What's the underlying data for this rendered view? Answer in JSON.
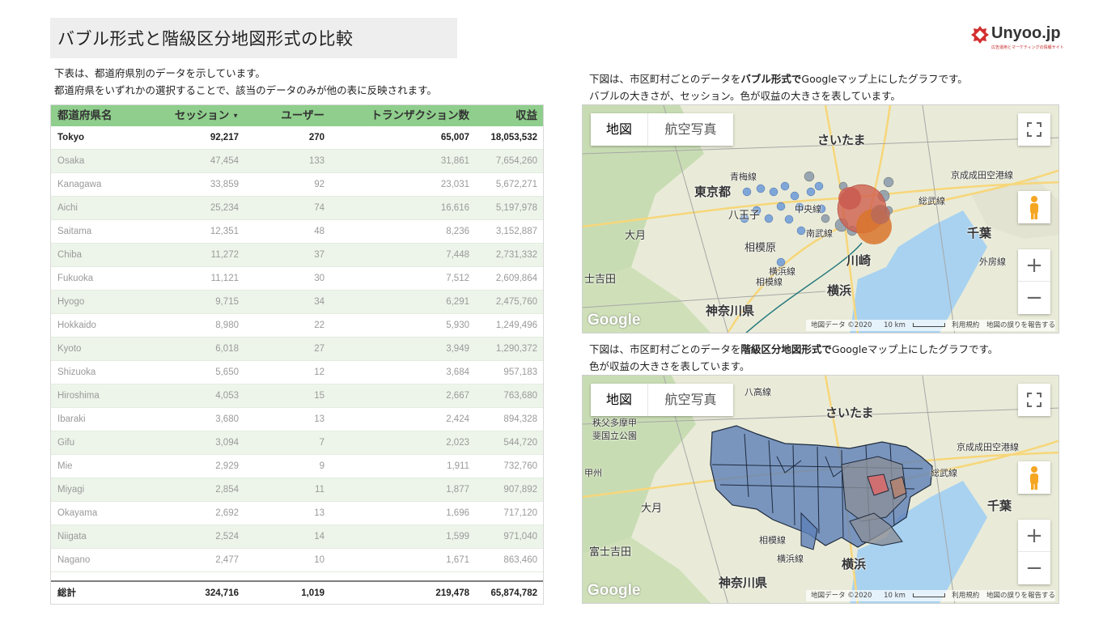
{
  "title": "バブル形式と階級区分地図形式の比較",
  "logo": {
    "brand": "Unyoo.jp",
    "tagline": "広告運用とマーケティングの情報サイト"
  },
  "table_desc": {
    "line1": "下表は、都道府県別のデータを示しています。",
    "line2": "都道府県をいずれかの選択することで、該当のデータのみが他の表に反映されます。"
  },
  "table": {
    "headers": [
      "都道府県名",
      "セッション",
      "ユーザー",
      "トランザクション数",
      "収益"
    ],
    "sort_indicator": "▼",
    "rows": [
      [
        "Tokyo",
        "92,217",
        "270",
        "65,007",
        "18,053,532"
      ],
      [
        "Osaka",
        "47,454",
        "133",
        "31,861",
        "7,654,260"
      ],
      [
        "Kanagawa",
        "33,859",
        "92",
        "23,031",
        "5,672,271"
      ],
      [
        "Aichi",
        "25,234",
        "74",
        "16,616",
        "5,197,978"
      ],
      [
        "Saitama",
        "12,351",
        "48",
        "8,236",
        "3,152,887"
      ],
      [
        "Chiba",
        "11,272",
        "37",
        "7,448",
        "2,731,332"
      ],
      [
        "Fukuoka",
        "11,121",
        "30",
        "7,512",
        "2,609,864"
      ],
      [
        "Hyogo",
        "9,715",
        "34",
        "6,291",
        "2,475,760"
      ],
      [
        "Hokkaido",
        "8,980",
        "22",
        "5,930",
        "1,249,496"
      ],
      [
        "Kyoto",
        "6,018",
        "27",
        "3,949",
        "1,290,372"
      ],
      [
        "Shizuoka",
        "5,650",
        "12",
        "3,684",
        "957,183"
      ],
      [
        "Hiroshima",
        "4,053",
        "15",
        "2,667",
        "763,680"
      ],
      [
        "Ibaraki",
        "3,680",
        "13",
        "2,424",
        "894,328"
      ],
      [
        "Gifu",
        "3,094",
        "7",
        "2,023",
        "544,720"
      ],
      [
        "Mie",
        "2,929",
        "9",
        "1,911",
        "732,760"
      ],
      [
        "Miyagi",
        "2,854",
        "11",
        "1,877",
        "907,892"
      ],
      [
        "Okayama",
        "2,692",
        "13",
        "1,696",
        "717,120"
      ],
      [
        "Niigata",
        "2,524",
        "14",
        "1,599",
        "971,040"
      ],
      [
        "Nagano",
        "2,477",
        "10",
        "1,671",
        "863,460"
      ]
    ],
    "total": [
      "総計",
      "324,716",
      "1,019",
      "219,478",
      "65,874,782"
    ]
  },
  "bubble_desc": {
    "line1_pre": "下図は、市区町村ごとのデータを",
    "line1_bold": "バブル形式で",
    "line1_post": "Googleマップ上にしたグラフです。",
    "line2": "バブルの大きさが、セッション。色が収益の大きさを表しています。"
  },
  "choropleth_desc": {
    "line1_pre": "下図は、市区町村ごとのデータを",
    "line1_bold": "階級区分地図形式で",
    "line1_post": "Googleマップ上にしたグラフです。",
    "line2": "色が収益の大きさを表しています。"
  },
  "map": {
    "type_map": "地図",
    "type_satellite": "航空写真",
    "google": "Google",
    "map_data": "地図データ ©2020",
    "scale": "10 km",
    "terms": "利用規約",
    "report": "地図の誤りを報告する",
    "zoom_in": "+",
    "zoom_out": "−",
    "labels_top": {
      "saitama": "さいたま",
      "tokyo": "東京都",
      "hachioji": "八王子",
      "chuo": "中央線",
      "otsuki": "大月",
      "sagamihara": "相模原",
      "nambu": "南武線",
      "kawasaki": "川崎",
      "yokohama": "横浜",
      "kanagawa": "神奈川県",
      "chiba": "千葉",
      "narita": "京成成田空港線",
      "sobu": "総武線",
      "sotobo": "外房線",
      "fujiyoshida": "士吉田",
      "yokohamasen": "横浜線",
      "ome": "青梅線",
      "sagami": "相模線"
    },
    "labels_bottom": {
      "saitama": "さいたま",
      "park": "秩父多摩甲斐国立公園",
      "otsuki": "大月",
      "fujiyoshida": "富士吉田",
      "chiba": "千葉",
      "yokohama": "横浜",
      "kanagawa": "神奈川県",
      "narita": "京成成田空港線",
      "sobu": "総武線",
      "sagami": "相模線",
      "yokohamasen": "横浜線",
      "koshu": "甲州",
      "hachikosen": "八高線"
    }
  }
}
